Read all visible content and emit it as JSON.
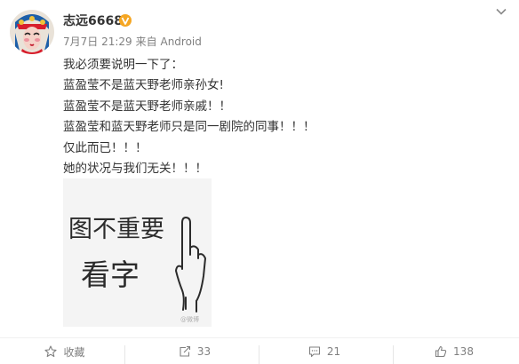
{
  "post": {
    "author": "志远6668",
    "verified_badge": "vip-v-icon",
    "date": "7月7日 21:29",
    "source": "来自 Android",
    "menu_icon": "chevron-down-icon",
    "lines": [
      "我必须要说明一下了：",
      "蓝盈莹不是蓝天野老师亲孙女!",
      "蓝盈莹不是蓝天野老师亲戚！！",
      "蓝盈莹和蓝天野老师只是同一剧院的同事！！！",
      "仅此而已！！！",
      "她的状况与我们无关！！！"
    ],
    "image": {
      "handwriting_line1": "图不重要",
      "handwriting_line2": "看字",
      "watermark": "@微博"
    }
  },
  "actions": {
    "favorite": {
      "icon": "star-icon",
      "label": "收藏"
    },
    "repost": {
      "icon": "repost-icon",
      "count": "33"
    },
    "comment": {
      "icon": "comment-icon",
      "count": "21"
    },
    "like": {
      "icon": "thumbs-up-icon",
      "count": "138"
    }
  },
  "colors": {
    "text": "#333333",
    "meta": "#808080",
    "badge": "#f5a623",
    "divider": "#f0f0f0"
  }
}
